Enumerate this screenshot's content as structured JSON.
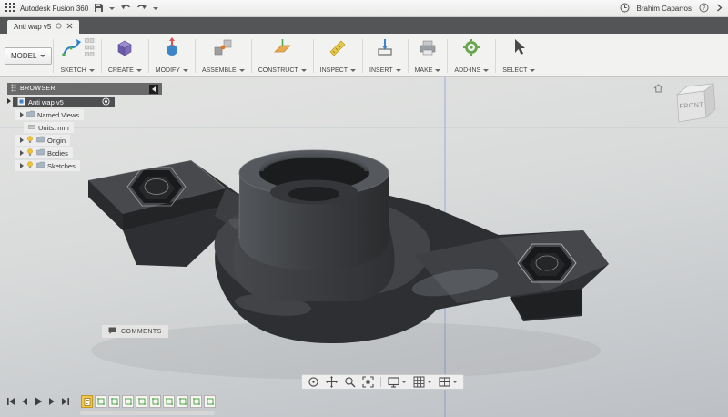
{
  "titlebar": {
    "app_title": "Autodesk Fusion 360",
    "user_name": "Brahim Caparros"
  },
  "tabbar": {
    "active_tab": "Anti wap v5"
  },
  "toolbar": {
    "model_label": "MODEL",
    "groups": [
      {
        "label": "SKETCH",
        "icon": "sketch-spline-icon"
      },
      {
        "label": "CREATE",
        "icon": "create-box-icon"
      },
      {
        "label": "MODIFY",
        "icon": "modify-press-pull-icon"
      },
      {
        "label": "ASSEMBLE",
        "icon": "assemble-joint-icon"
      },
      {
        "label": "CONSTRUCT",
        "icon": "construct-plane-icon"
      },
      {
        "label": "INSPECT",
        "icon": "inspect-measure-icon"
      },
      {
        "label": "INSERT",
        "icon": "insert-arrow-icon"
      },
      {
        "label": "MAKE",
        "icon": "make-printer-icon"
      },
      {
        "label": "ADD-INS",
        "icon": "add-ins-gear-icon"
      },
      {
        "label": "SELECT",
        "icon": "select-cursor-icon"
      }
    ]
  },
  "browser": {
    "header": "BROWSER",
    "root_label": "Anti wap v5",
    "items": [
      {
        "label": "Named Views"
      },
      {
        "label": "Units: mm"
      },
      {
        "label": "Origin"
      },
      {
        "label": "Bodies"
      },
      {
        "label": "Sketches"
      }
    ]
  },
  "viewcube": {
    "face_label": "FRONT"
  },
  "canvas": {
    "comments_label": "COMMENTS"
  },
  "navbar_icons": [
    "orbit-icon",
    "pan-icon",
    "zoom-icon",
    "fit-icon",
    "display-settings-icon",
    "grid-settings-icon",
    "viewports-icon"
  ],
  "timeline": {
    "playback_icons": [
      "skip-start-icon",
      "step-back-icon",
      "play-icon",
      "step-forward-icon",
      "skip-end-icon"
    ],
    "feature_icon_count": 10
  },
  "colors": {
    "timeline_active": "#f2c74c",
    "axis_blue": "#5b7bc4",
    "bulb_yellow": "#f2c230",
    "part_gray": "#3d3f42"
  }
}
